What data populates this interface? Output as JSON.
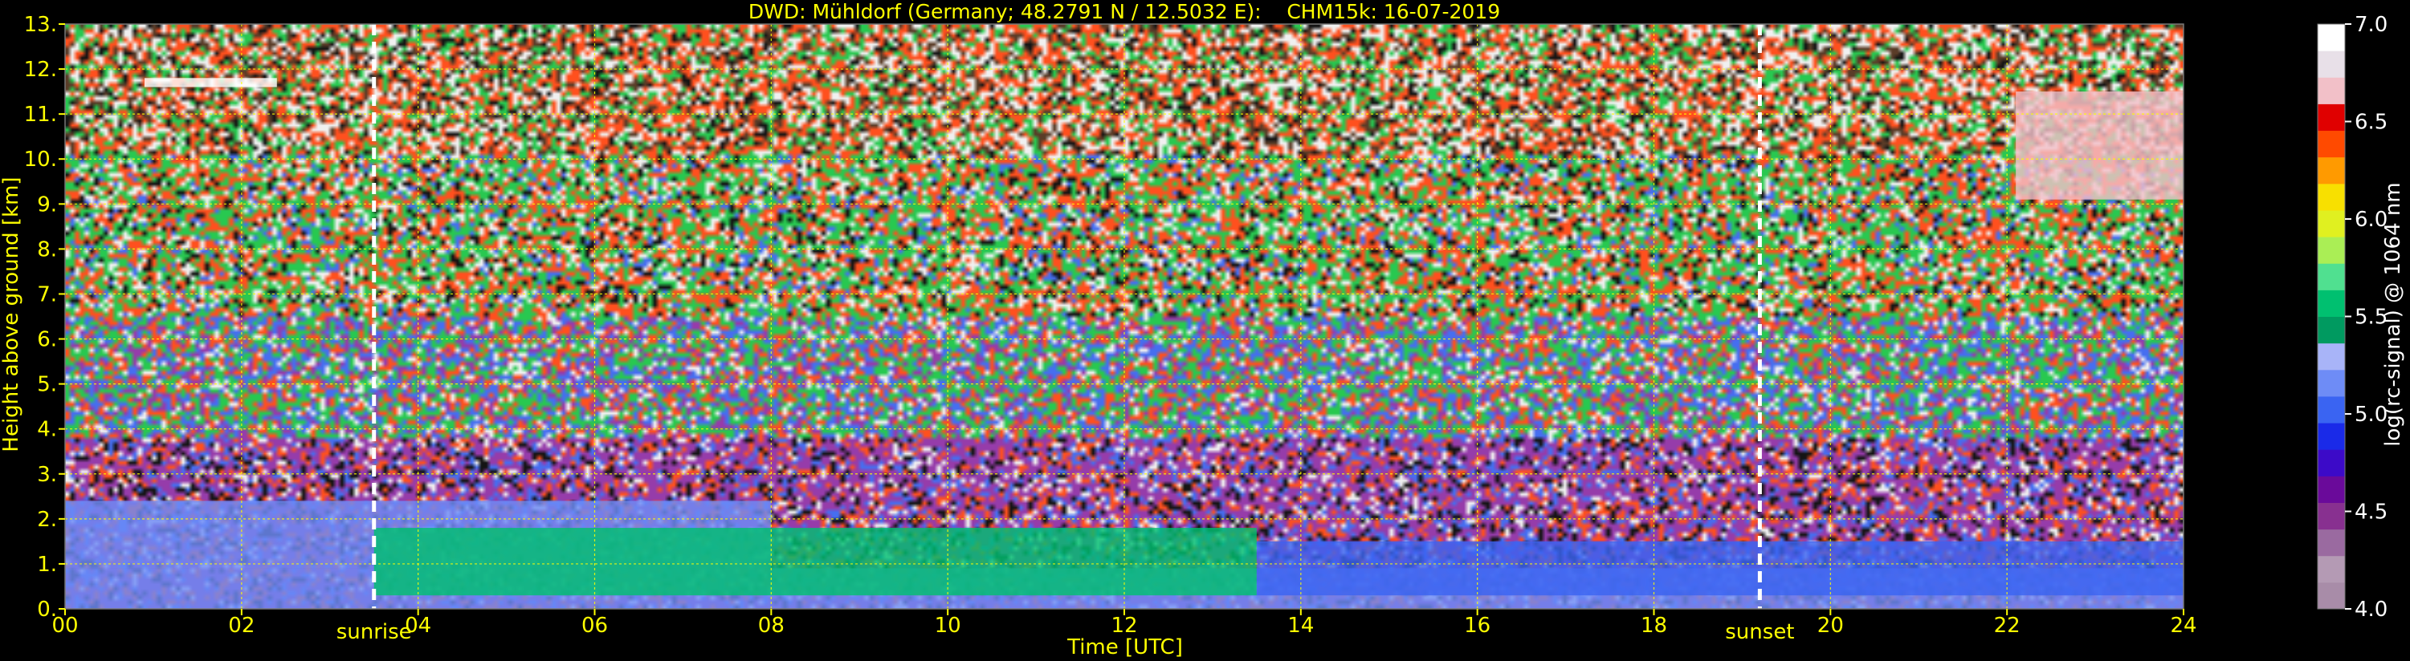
{
  "chart_data": {
    "type": "heatmap",
    "title": "DWD: Mühldorf (Germany; 48.2791 N / 12.5032 E):    CHM15k: 16-07-2019",
    "xlabel": "Time [UTC]",
    "ylabel": "Height above ground [km]",
    "colorbar_label": "log(rc-signal) @ 1064 nm",
    "xlim": [
      0,
      24
    ],
    "ylim": [
      0,
      13
    ],
    "color_range": [
      4.0,
      7.0
    ],
    "x_ticks": [
      "00",
      "02",
      "04",
      "06",
      "08",
      "10",
      "12",
      "14",
      "16",
      "18",
      "20",
      "22",
      "24"
    ],
    "x_tick_values": [
      0,
      2,
      4,
      6,
      8,
      10,
      12,
      14,
      16,
      18,
      20,
      22,
      24
    ],
    "y_ticks": [
      "0.",
      "1.",
      "2.",
      "3.",
      "4.",
      "5.",
      "6.",
      "7.",
      "8.",
      "9.",
      "10.",
      "11.",
      "12.",
      "13."
    ],
    "y_tick_values": [
      0,
      1,
      2,
      3,
      4,
      5,
      6,
      7,
      8,
      9,
      10,
      11,
      12,
      13
    ],
    "colorbar_ticks": [
      "4.0",
      "4.5",
      "5.0",
      "5.5",
      "6.0",
      "6.5",
      "7.0"
    ],
    "colorbar_tick_values": [
      4.0,
      4.5,
      5.0,
      5.5,
      6.0,
      6.5,
      7.0
    ],
    "grid": true,
    "events": [
      {
        "label": "sunrise",
        "time": 3.5
      },
      {
        "label": "sunset",
        "time": 19.2
      }
    ],
    "layers": [
      {
        "t_start": 0,
        "t_end": 24,
        "h_bottom": 0.0,
        "h_top": 0.9,
        "level": 5.1
      },
      {
        "t_start": 0,
        "t_end": 8,
        "h_bottom": 0.9,
        "h_top": 2.4,
        "level": 5.2
      },
      {
        "t_start": 3.5,
        "t_end": 13.5,
        "h_bottom": 0.3,
        "h_top": 1.8,
        "level": 5.5
      },
      {
        "t_start": 13.5,
        "t_end": 24,
        "h_bottom": 0.3,
        "h_top": 1.5,
        "level": 5.0
      },
      {
        "t_start": 0.9,
        "t_end": 2.4,
        "h_bottom": 11.6,
        "h_top": 11.8,
        "level": 7.0
      },
      {
        "t_start": 22.1,
        "t_end": 24,
        "h_bottom": 9.1,
        "h_top": 11.5,
        "level": 6.6
      }
    ],
    "colormap": [
      "#a88ca8",
      "#b49ab4",
      "#9a6aa0",
      "#883090",
      "#6a0a9a",
      "#3c0ac8",
      "#1a2ae8",
      "#3a64f2",
      "#6e8cf6",
      "#a8b4f8",
      "#009a60",
      "#00c070",
      "#50e090",
      "#aaee55",
      "#e0f020",
      "#f8e000",
      "#ff9a00",
      "#ff4a00",
      "#e00000",
      "#f2c0c8",
      "#e8e0e8",
      "#ffffff"
    ]
  }
}
